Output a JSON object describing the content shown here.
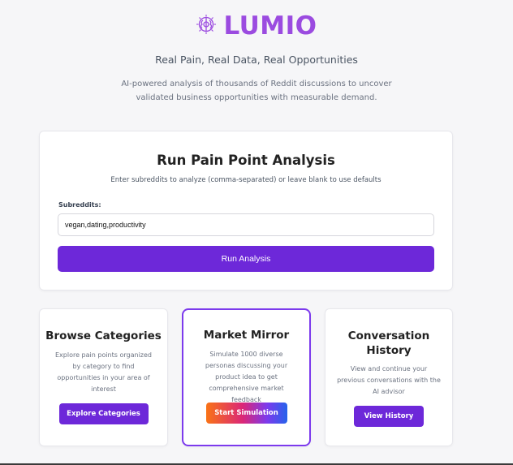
{
  "brand": {
    "name": "LUMIO",
    "logo_icon": "brain-icon",
    "accent": "#9b4be0"
  },
  "hero": {
    "tagline": "Real Pain, Real Data, Real Opportunities",
    "description": "AI-powered analysis of thousands of Reddit discussions to uncover validated business opportunities with measurable demand."
  },
  "analysis": {
    "title": "Run Pain Point Analysis",
    "subtitle": "Enter subreddits to analyze (comma-separated) or leave blank to use defaults",
    "field_label": "Subreddits:",
    "field_value": "vegan,dating,productivity",
    "button_label": "Run Analysis",
    "button_color": "#6d28d9"
  },
  "features": [
    {
      "title": "Browse Categories",
      "description": "Explore pain points organized by category to find opportunities in your area of interest",
      "button": "Explore Categories"
    },
    {
      "title": "Market Mirror",
      "description": "Simulate 1000 diverse personas discussing your product idea to get comprehensive market feedback",
      "button": "Start Simulation"
    },
    {
      "title": "Conversation History",
      "description": "View and continue your previous conversations with the AI advisor",
      "button": "View History"
    }
  ]
}
